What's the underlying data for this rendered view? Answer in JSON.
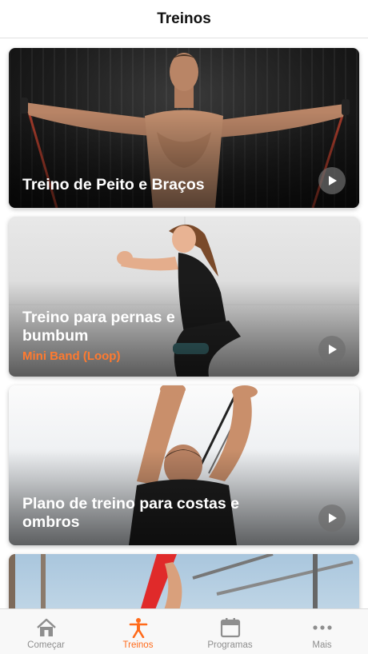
{
  "header": {
    "title": "Treinos"
  },
  "cards": [
    {
      "title": "Treino de Peito e Braços",
      "subtitle": ""
    },
    {
      "title": "Treino para pernas e bumbum",
      "subtitle": "Mini Band (Loop)"
    },
    {
      "title": "Plano de treino para costas e ombros",
      "subtitle": ""
    }
  ],
  "tabbar": {
    "items": [
      {
        "label": "Começar",
        "icon": "home-icon"
      },
      {
        "label": "Treinos",
        "icon": "exercise-person-icon",
        "active": true
      },
      {
        "label": "Programas",
        "icon": "calendar-icon"
      },
      {
        "label": "Mais",
        "icon": "more-dots-icon"
      }
    ]
  },
  "colors": {
    "accent": "#ff6a1a",
    "subtitle": "#ff7a2f",
    "inactive": "#8e8e8e"
  }
}
